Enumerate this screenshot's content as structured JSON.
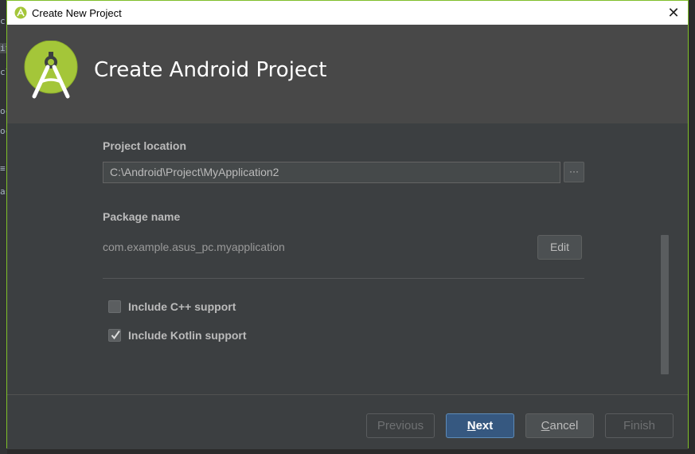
{
  "window": {
    "title": "Create New Project",
    "close_glyph": "✕",
    "app_icon": "android-studio-icon"
  },
  "header": {
    "title": "Create Android Project",
    "logo": "android-studio-logo"
  },
  "background_ide": {
    "glyphs": [
      "c",
      "it",
      "cl",
      "oc",
      "oc",
      "≡",
      "as"
    ]
  },
  "form": {
    "project_location": {
      "label": "Project location",
      "value": "C:\\Android\\Project\\MyApplication2",
      "browse_label": "···"
    },
    "package_name": {
      "label": "Package name",
      "value": "com.example.asus_pc.myapplication",
      "edit_label": "Edit"
    },
    "options": [
      {
        "label": "Include C++ support",
        "checked": false
      },
      {
        "label": "Include Kotlin support",
        "checked": true
      }
    ]
  },
  "footer": {
    "buttons": [
      {
        "label": "Previous",
        "state": "disabled"
      },
      {
        "label": "Next",
        "state": "default"
      },
      {
        "label": "Cancel",
        "state": "enabled"
      },
      {
        "label": "Finish",
        "state": "disabled"
      }
    ]
  },
  "colors": {
    "accent_green": "#a4c639",
    "window_border": "#7fbf2a",
    "primary_button": "#365880"
  }
}
